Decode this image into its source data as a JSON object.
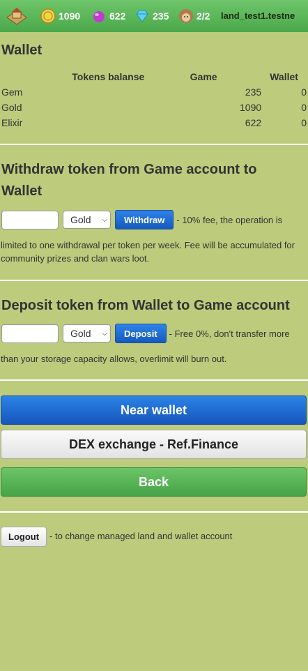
{
  "topbar": {
    "gold": "1090",
    "elixir": "622",
    "gem": "235",
    "workers": "2/2",
    "account": "land_test1.testne",
    "icons": [
      "land-icon",
      "gold-coin-icon",
      "elixir-icon",
      "gem-icon",
      "worker-icon"
    ]
  },
  "wallet": {
    "title": "Wallet",
    "headers": {
      "token": "Tokens balanse",
      "game": "Game",
      "wallet": "Wallet"
    },
    "rows": [
      {
        "name": "Gem",
        "game": "235",
        "wallet": "0"
      },
      {
        "name": "Gold",
        "game": "1090",
        "wallet": "0"
      },
      {
        "name": "Elixir",
        "game": "622",
        "wallet": "0"
      }
    ]
  },
  "withdraw": {
    "title": "Withdraw token from Game account to Wallet",
    "amount": "",
    "token": "Gold",
    "button": "Withdraw",
    "note_inline": "- 10% fee, the operation is",
    "note": "limited to one withdrawal per token per week. Fee will be accumulated for community prizes and clan wars loot."
  },
  "deposit": {
    "title": "Deposit token from Wallet to Game account",
    "amount": "",
    "token": "Gold",
    "button": "Deposit",
    "note_inline": "- Free 0%, don't transfer more",
    "note": "than your storage capacity allows, overlimit will burn out."
  },
  "buttons": {
    "near": "Near wallet",
    "dex": "DEX exchange - Ref.Finance",
    "back": "Back",
    "logout": "Logout",
    "logout_note": "- to change managed land and wallet account"
  },
  "colors": {
    "background": "#bccb7c",
    "topbar": "#57b356",
    "blue_button": "#1f6fd6",
    "green_button": "#55b455"
  }
}
